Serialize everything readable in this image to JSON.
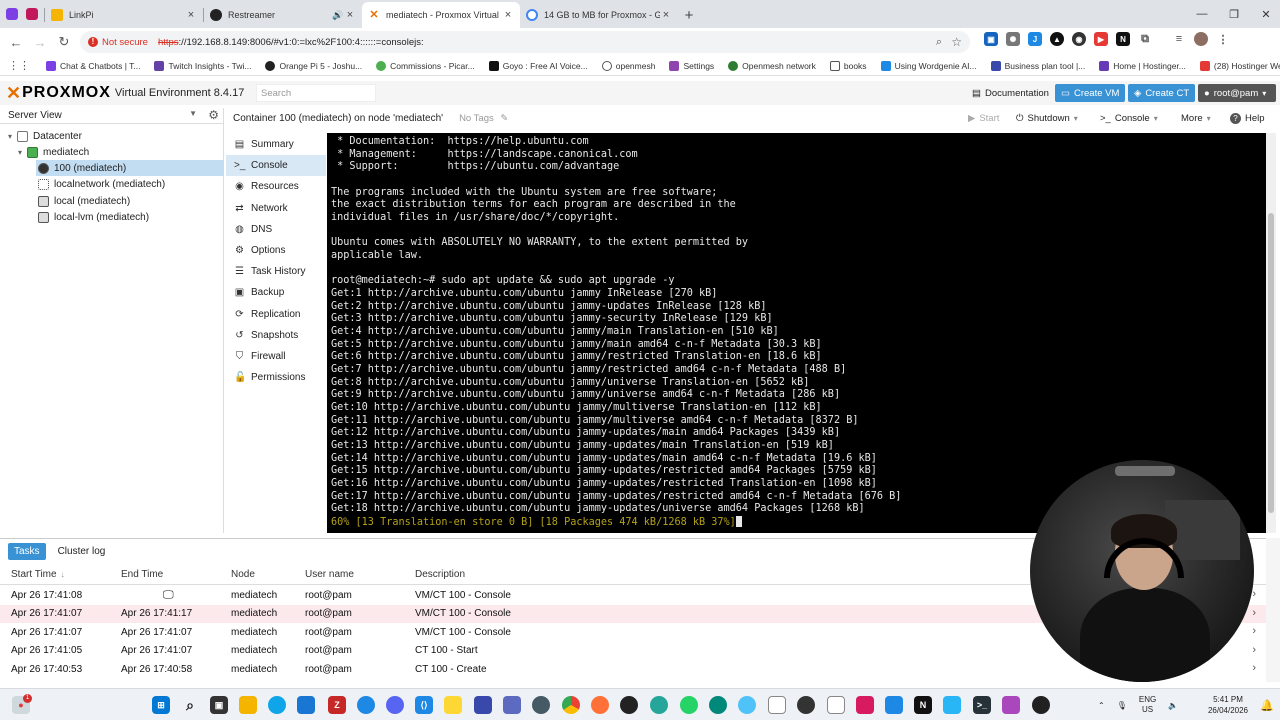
{
  "browser": {
    "tabs": [
      {
        "title": "LinkPi",
        "fav_color": "#f4b400"
      },
      {
        "title": "Restreamer",
        "fav_color": "#222222"
      },
      {
        "title": "mediatech - Proxmox Virtual E...",
        "fav_color": "#e57000"
      },
      {
        "title": "14 GB to MB for Proxmox - Goo...",
        "fav_color": "#4285f4"
      }
    ],
    "new_tab": "+",
    "url_warning": "Not secure",
    "url_scheme": "https",
    "url_rest": "://192.168.8.149:8006/#v1:0:=lxc%2F100:4::::::=consolejs:",
    "bookmarks": [
      {
        "label": "Chat & Chatbots | T...",
        "color": "#7b3fe4"
      },
      {
        "label": "Twitch Insights - Twi...",
        "color": "#6441a5"
      },
      {
        "label": "Orange Pi 5 - Joshu...",
        "color": "#222222"
      },
      {
        "label": "Commissions - Picar...",
        "color": "#4caf50"
      },
      {
        "label": "Goyo : Free AI Voice...",
        "color": "#111111"
      },
      {
        "label": "openmesh",
        "color": "#555555"
      },
      {
        "label": "Settings",
        "color": "#8e44ad"
      },
      {
        "label": "Openmesh network",
        "color": "#2e7d32"
      },
      {
        "label": "books",
        "color": "#777777"
      },
      {
        "label": "Using Wordgenie AI...",
        "color": "#1e88e5"
      },
      {
        "label": "Business plan tool |...",
        "color": "#3949ab"
      },
      {
        "label": "Home | Hostinger...",
        "color": "#673ab7"
      },
      {
        "label": "(28) Hostinger Web...",
        "color": "#e53935"
      }
    ]
  },
  "pve": {
    "brand": "PROXMOX",
    "version": "Virtual Environment 8.4.17",
    "search_placeholder": "Search",
    "buttons": {
      "documentation": "Documentation",
      "create_vm": "Create VM",
      "create_ct": "Create CT",
      "user": "root@pam"
    },
    "server_view": "Server View",
    "tree": [
      {
        "label": "Datacenter",
        "level": 0
      },
      {
        "label": "mediatech",
        "level": 1
      },
      {
        "label": "100 (mediatech)",
        "level": 2,
        "selected": true
      },
      {
        "label": "localnetwork (mediatech)",
        "level": 2
      },
      {
        "label": "local (mediatech)",
        "level": 2
      },
      {
        "label": "local-lvm (mediatech)",
        "level": 2
      }
    ],
    "content_title": "Container 100 (mediatech) on node 'mediatech'",
    "no_tags": "No Tags",
    "actions": {
      "start": "Start",
      "shutdown": "Shutdown",
      "console": "Console",
      "more": "More",
      "help": "Help"
    },
    "menu": [
      {
        "label": "Summary",
        "icon": "summary-icon"
      },
      {
        "label": "Console",
        "icon": "console-icon",
        "selected": true
      },
      {
        "label": "Resources",
        "icon": "resources-icon"
      },
      {
        "label": "Network",
        "icon": "network-icon"
      },
      {
        "label": "DNS",
        "icon": "dns-icon"
      },
      {
        "label": "Options",
        "icon": "options-icon"
      },
      {
        "label": "Task History",
        "icon": "task-history-icon"
      },
      {
        "label": "Backup",
        "icon": "backup-icon"
      },
      {
        "label": "Replication",
        "icon": "replication-icon"
      },
      {
        "label": "Snapshots",
        "icon": "snapshots-icon"
      },
      {
        "label": "Firewall",
        "icon": "firewall-icon"
      },
      {
        "label": "Permissions",
        "icon": "permissions-icon"
      }
    ],
    "terminal_lines": [
      " * Documentation:  https://help.ubuntu.com",
      " * Management:     https://landscape.canonical.com",
      " * Support:        https://ubuntu.com/advantage",
      "",
      "The programs included with the Ubuntu system are free software;",
      "the exact distribution terms for each program are described in the",
      "individual files in /usr/share/doc/*/copyright.",
      "",
      "Ubuntu comes with ABSOLUTELY NO WARRANTY, to the extent permitted by",
      "applicable law.",
      "",
      "root@mediatech:~# sudo apt update && sudo apt upgrade -y",
      "Get:1 http://archive.ubuntu.com/ubuntu jammy InRelease [270 kB]",
      "Get:2 http://archive.ubuntu.com/ubuntu jammy-updates InRelease [128 kB]",
      "Get:3 http://archive.ubuntu.com/ubuntu jammy-security InRelease [129 kB]",
      "Get:4 http://archive.ubuntu.com/ubuntu jammy/main Translation-en [510 kB]",
      "Get:5 http://archive.ubuntu.com/ubuntu jammy/main amd64 c-n-f Metadata [30.3 kB]",
      "Get:6 http://archive.ubuntu.com/ubuntu jammy/restricted Translation-en [18.6 kB]",
      "Get:7 http://archive.ubuntu.com/ubuntu jammy/restricted amd64 c-n-f Metadata [488 B]",
      "Get:8 http://archive.ubuntu.com/ubuntu jammy/universe Translation-en [5652 kB]",
      "Get:9 http://archive.ubuntu.com/ubuntu jammy/universe amd64 c-n-f Metadata [286 kB]",
      "Get:10 http://archive.ubuntu.com/ubuntu jammy/multiverse Translation-en [112 kB]",
      "Get:11 http://archive.ubuntu.com/ubuntu jammy/multiverse amd64 c-n-f Metadata [8372 B]",
      "Get:12 http://archive.ubuntu.com/ubuntu jammy-updates/main amd64 Packages [3439 kB]",
      "Get:13 http://archive.ubuntu.com/ubuntu jammy-updates/main Translation-en [519 kB]",
      "Get:14 http://archive.ubuntu.com/ubuntu jammy-updates/main amd64 c-n-f Metadata [19.6 kB]",
      "Get:15 http://archive.ubuntu.com/ubuntu jammy-updates/restricted amd64 Packages [5759 kB]",
      "Get:16 http://archive.ubuntu.com/ubuntu jammy-updates/restricted Translation-en [1098 kB]",
      "Get:17 http://archive.ubuntu.com/ubuntu jammy-updates/restricted amd64 c-n-f Metadata [676 B]",
      "Get:18 http://archive.ubuntu.com/ubuntu jammy-updates/universe amd64 Packages [1268 kB]"
    ],
    "terminal_progress": "60% [13 Translation-en store 0 B] [18 Packages 474 kB/1268 kB 37%]",
    "tasks": {
      "tabs": [
        "Tasks",
        "Cluster log"
      ],
      "columns": [
        "Start Time",
        "End Time",
        "Node",
        "User name",
        "Description"
      ],
      "rows": [
        {
          "start": "Apr 26 17:41:08",
          "end": "",
          "node": "mediatech",
          "user": "root@pam",
          "desc": "VM/CT 100 - Console",
          "running": true
        },
        {
          "start": "Apr 26 17:41:07",
          "end": "Apr 26 17:41:17",
          "node": "mediatech",
          "user": "root@pam",
          "desc": "VM/CT 100 - Console"
        },
        {
          "start": "Apr 26 17:41:07",
          "end": "Apr 26 17:41:07",
          "node": "mediatech",
          "user": "root@pam",
          "desc": "VM/CT 100 - Console"
        },
        {
          "start": "Apr 26 17:41:05",
          "end": "Apr 26 17:41:07",
          "node": "mediatech",
          "user": "root@pam",
          "desc": "CT 100 - Start"
        },
        {
          "start": "Apr 26 17:40:53",
          "end": "Apr 26 17:40:58",
          "node": "mediatech",
          "user": "root@pam",
          "desc": "CT 100 - Create"
        }
      ]
    }
  },
  "taskbar": {
    "lang_top": "ENG",
    "lang_bottom": "US",
    "time": "5:41 PM",
    "date": "26/04/2026",
    "notification_badge": "1"
  },
  "colors": {
    "accent": "#3892d4",
    "proxmox_orange": "#e57000",
    "terminal_bg": "#000000",
    "progress_text": "#b4a21c"
  }
}
